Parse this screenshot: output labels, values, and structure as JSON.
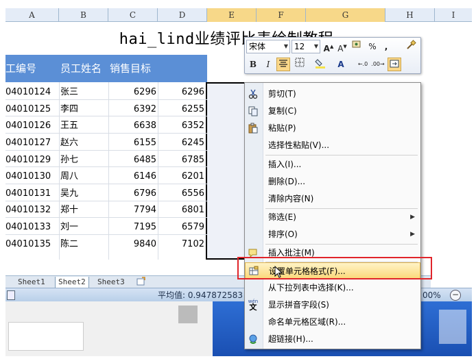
{
  "columns": [
    "A",
    "B",
    "C",
    "D",
    "E",
    "F",
    "G",
    "H",
    "I"
  ],
  "title": "hai_lind业绩评比表绘制教程",
  "headers": [
    "工编号",
    "员工姓名",
    "销售目标"
  ],
  "rows": [
    [
      "04010124",
      "张三",
      "6296",
      "6296"
    ],
    [
      "04010125",
      "李四",
      "6392",
      "6255"
    ],
    [
      "04010126",
      "王五",
      "6638",
      "6352"
    ],
    [
      "04010127",
      "赵六",
      "6155",
      "6245"
    ],
    [
      "04010129",
      "孙七",
      "6485",
      "6785"
    ],
    [
      "04010130",
      "周八",
      "6146",
      "6201"
    ],
    [
      "04010131",
      "吴九",
      "6796",
      "6556"
    ],
    [
      "04010132",
      "郑十",
      "7794",
      "6801"
    ],
    [
      "04010133",
      "刘一",
      "7195",
      "6579"
    ],
    [
      "04010135",
      "陈二",
      "9840",
      "7102"
    ]
  ],
  "sheet_tabs": [
    "Sheet1",
    "Sheet2",
    "Sheet3"
  ],
  "status": {
    "average": "平均值: 0.947872583",
    "zoom": "00%"
  },
  "mini_toolbar": {
    "font": "宋体",
    "size": "12",
    "percent": "%",
    "comma": ",",
    "bold": "B",
    "italic": "I"
  },
  "menu": [
    {
      "label": "剪切(T)",
      "icon": "scissors-icon"
    },
    {
      "label": "复制(C)",
      "icon": "copy-icon"
    },
    {
      "label": "粘贴(P)",
      "icon": "paste-icon"
    },
    {
      "label": "选择性粘贴(V)..."
    },
    {
      "label": "插入(I)..."
    },
    {
      "label": "删除(D)..."
    },
    {
      "label": "清除内容(N)"
    },
    {
      "label": "筛选(E)"
    },
    {
      "label": "排序(O)"
    },
    {
      "label": "插入批注(M)",
      "icon": "comment-icon"
    },
    {
      "label": "设置单元格格式(F)...",
      "icon": "format-cells-icon"
    },
    {
      "label": "从下拉列表中选择(K)..."
    },
    {
      "label": "显示拼音字段(S)",
      "icon": "phonetic-icon",
      "icon_text": "wén"
    },
    {
      "label": "命名单元格区域(R)..."
    },
    {
      "label": "超链接(H)...",
      "icon": "hyperlink-icon"
    }
  ]
}
